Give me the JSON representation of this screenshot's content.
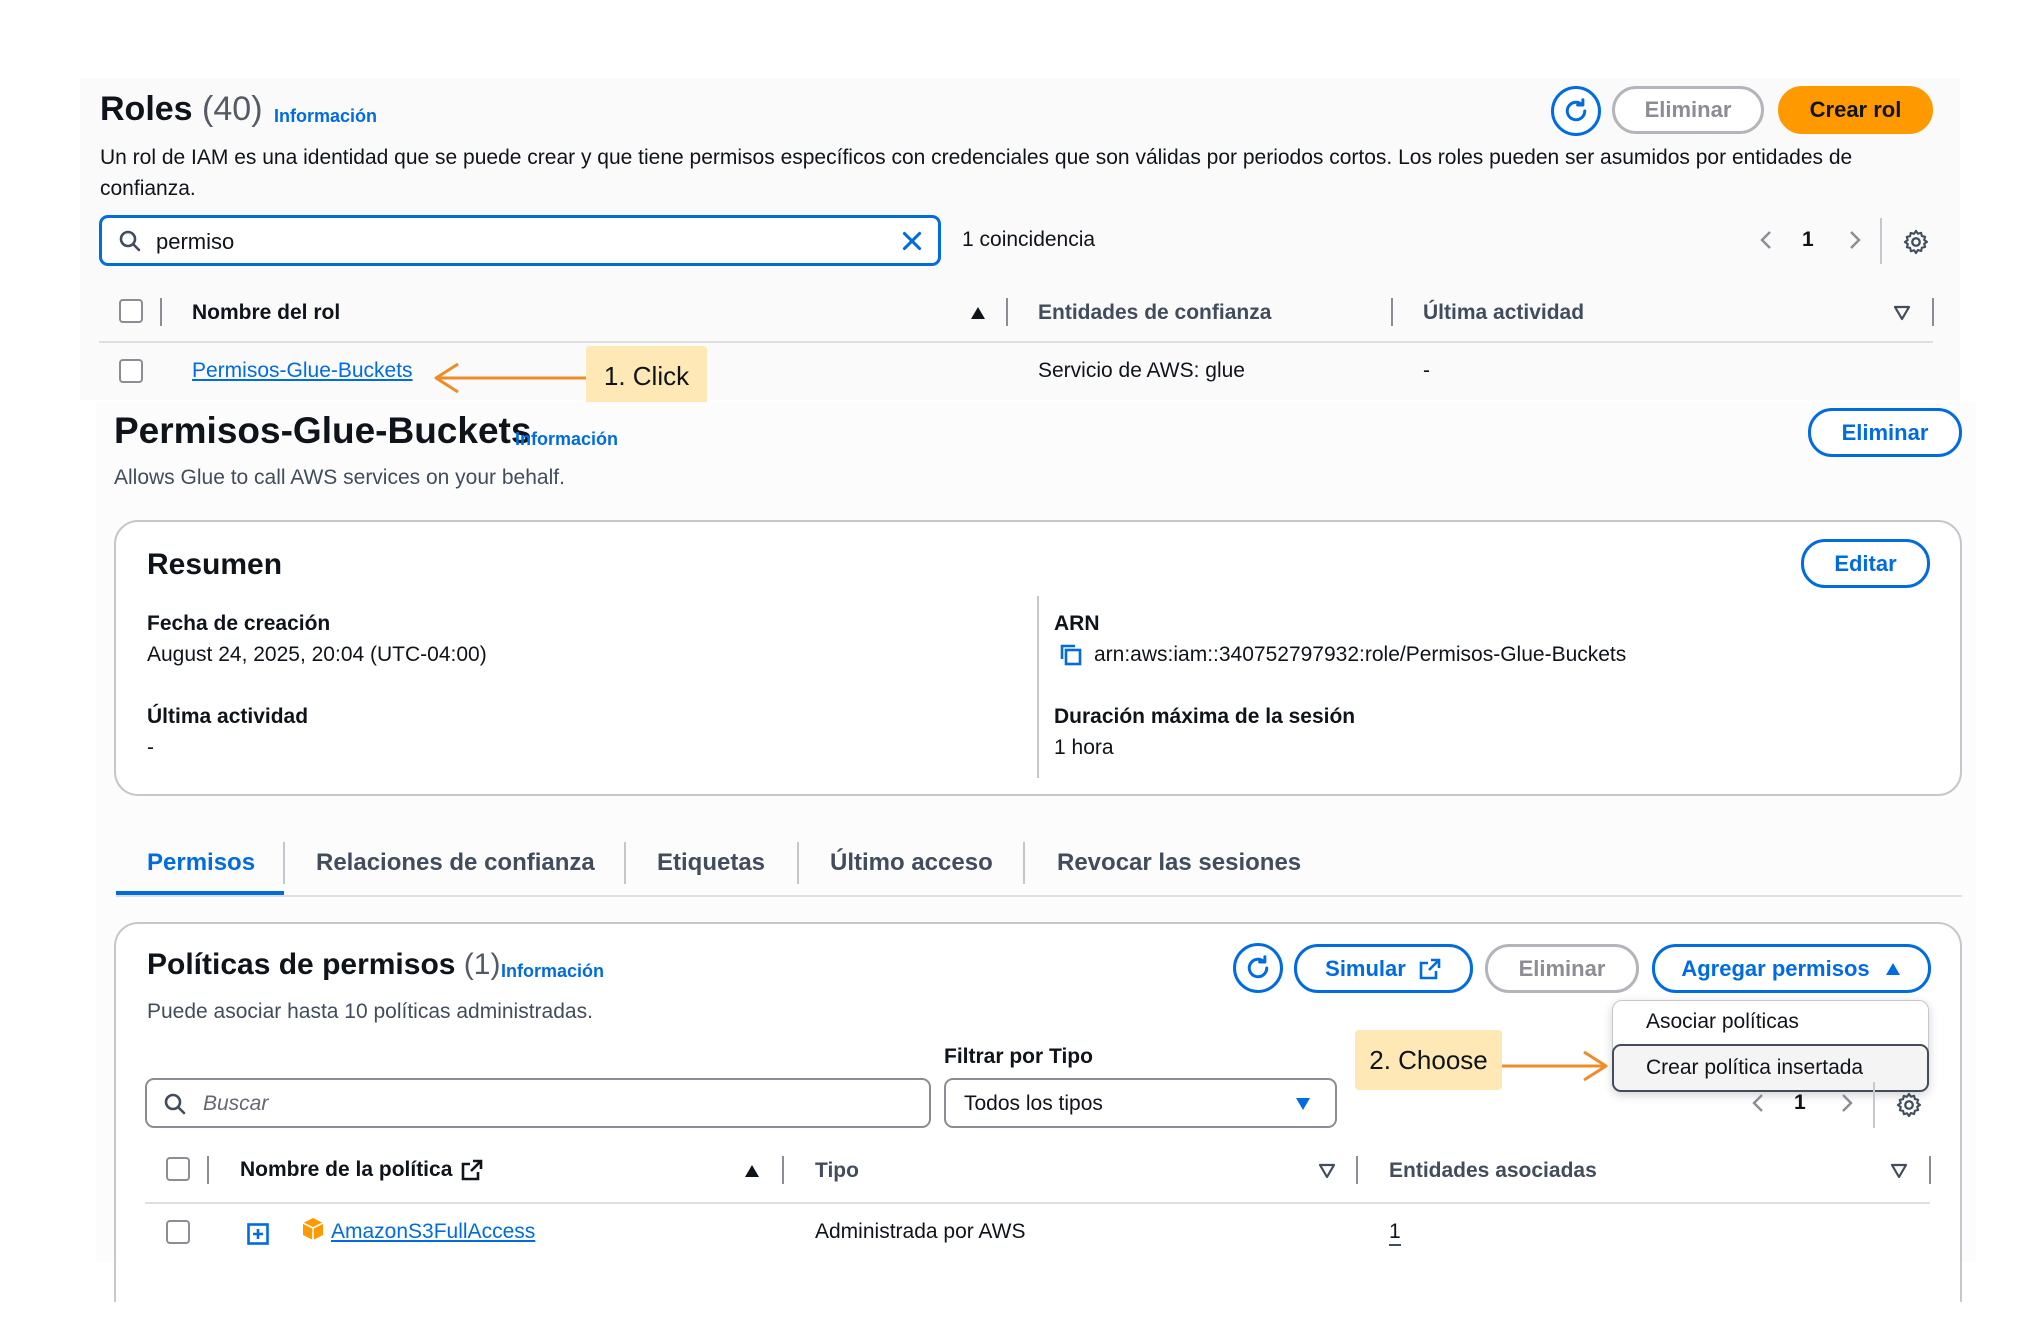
{
  "colors": {
    "accent": "#006ce0",
    "primary": "#ff9900",
    "callout": "#fde8b6",
    "arrow": "#f08c28"
  },
  "roles": {
    "title": "Roles",
    "count": "(40)",
    "info": "Información",
    "description": "Un rol de IAM es una identidad que se puede crear y que tiene permisos específicos con credenciales que son válidas por periodos cortos. Los roles pueden ser asumidos por entidades de confianza.",
    "buttons": {
      "delete": "Eliminar",
      "create": "Crear rol"
    },
    "search": {
      "value": "permiso",
      "matches": "1 coincidencia"
    },
    "pagination": {
      "page": "1"
    },
    "columns": {
      "name": "Nombre del rol",
      "trusted": "Entidades de confianza",
      "last_activity": "Última actividad"
    },
    "rows": [
      {
        "name": "Permisos-Glue-Buckets",
        "trusted": "Servicio de AWS: glue",
        "last_activity": "-"
      }
    ]
  },
  "callouts": {
    "step1": "1. Click",
    "step2": "2. Choose"
  },
  "role": {
    "title": "Permisos-Glue-Buckets",
    "info": "Información",
    "description": "Allows Glue to call AWS services on your behalf.",
    "delete": "Eliminar",
    "summary": {
      "title": "Resumen",
      "edit": "Editar",
      "created_label": "Fecha de creación",
      "created_value": "August 24, 2025, 20:04 (UTC-04:00)",
      "last_activity_label": "Última actividad",
      "last_activity_value": "-",
      "arn_label": "ARN",
      "arn_value": "arn:aws:iam::340752797932:role/Permisos-Glue-Buckets",
      "max_session_label": "Duración máxima de la sesión",
      "max_session_value": "1 hora"
    },
    "tabs": [
      "Permisos",
      "Relaciones de confianza",
      "Etiquetas",
      "Último acceso",
      "Revocar las sesiones"
    ],
    "policies": {
      "title": "Políticas de permisos",
      "count": "(1)",
      "info": "Información",
      "description": "Puede asociar hasta 10 políticas administradas.",
      "simulate": "Simular",
      "delete": "Eliminar",
      "add": "Agregar permisos",
      "menu": [
        "Asociar políticas",
        "Crear política insertada"
      ],
      "filter_label": "Filtrar por Tipo",
      "filter_value": "Todos los tipos",
      "search_placeholder": "Buscar",
      "page": "1",
      "columns": {
        "name": "Nombre de la política",
        "type": "Tipo",
        "entities": "Entidades asociadas"
      },
      "rows": [
        {
          "name": "AmazonS3FullAccess",
          "type": "Administrada por AWS",
          "entities": "1"
        }
      ]
    }
  }
}
